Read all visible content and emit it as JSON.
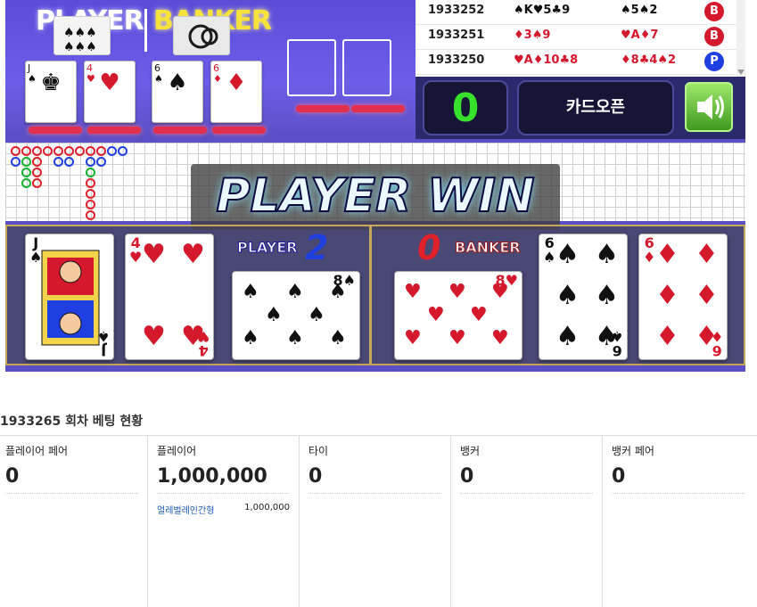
{
  "game": {
    "brand_player": "PLAYER",
    "brand_banker": "BANKER",
    "history": [
      {
        "round": "1933252",
        "player_cards": "♠K♥5♣9",
        "banker_cards": "♠5♠2",
        "result": "B"
      },
      {
        "round": "1933251",
        "player_cards": "♦3♠9",
        "banker_cards": "♥A♦7",
        "result": "B"
      },
      {
        "round": "1933250",
        "player_cards": "♥A♦10♣8",
        "banker_cards": "♦8♣4♠2",
        "result": "P"
      }
    ],
    "counter": "0",
    "open_button": "카드오픈",
    "banner": "PLAYER WIN",
    "player_label": "PLAYER",
    "player_score": "2",
    "banker_label": "BANKER",
    "banker_score": "0",
    "player_cards": [
      {
        "rank": "J",
        "suit": "♠"
      },
      {
        "rank": "4",
        "suit": "♥"
      },
      {
        "rank": "8",
        "suit": "♠"
      }
    ],
    "banker_cards": [
      {
        "rank": "6",
        "suit": "♠"
      },
      {
        "rank": "6",
        "suit": "♦"
      },
      {
        "rank": "8",
        "suit": "♥"
      }
    ],
    "colors": {
      "player": "#1f3fe0",
      "banker": "#e0202a",
      "tie": "#17b32c",
      "accent": "#37e02a"
    }
  },
  "betting": {
    "title": "1933265 회차 베팅 현황",
    "columns": [
      {
        "label": "플레이어 페어",
        "value": "0"
      },
      {
        "label": "플레이어",
        "value": "1,000,000",
        "bettor_name": "얼레벌레인간형",
        "bettor_amount": "1,000,000"
      },
      {
        "label": "타이",
        "value": "0"
      },
      {
        "label": "뱅커",
        "value": "0"
      },
      {
        "label": "뱅커 페어",
        "value": "0"
      }
    ]
  }
}
